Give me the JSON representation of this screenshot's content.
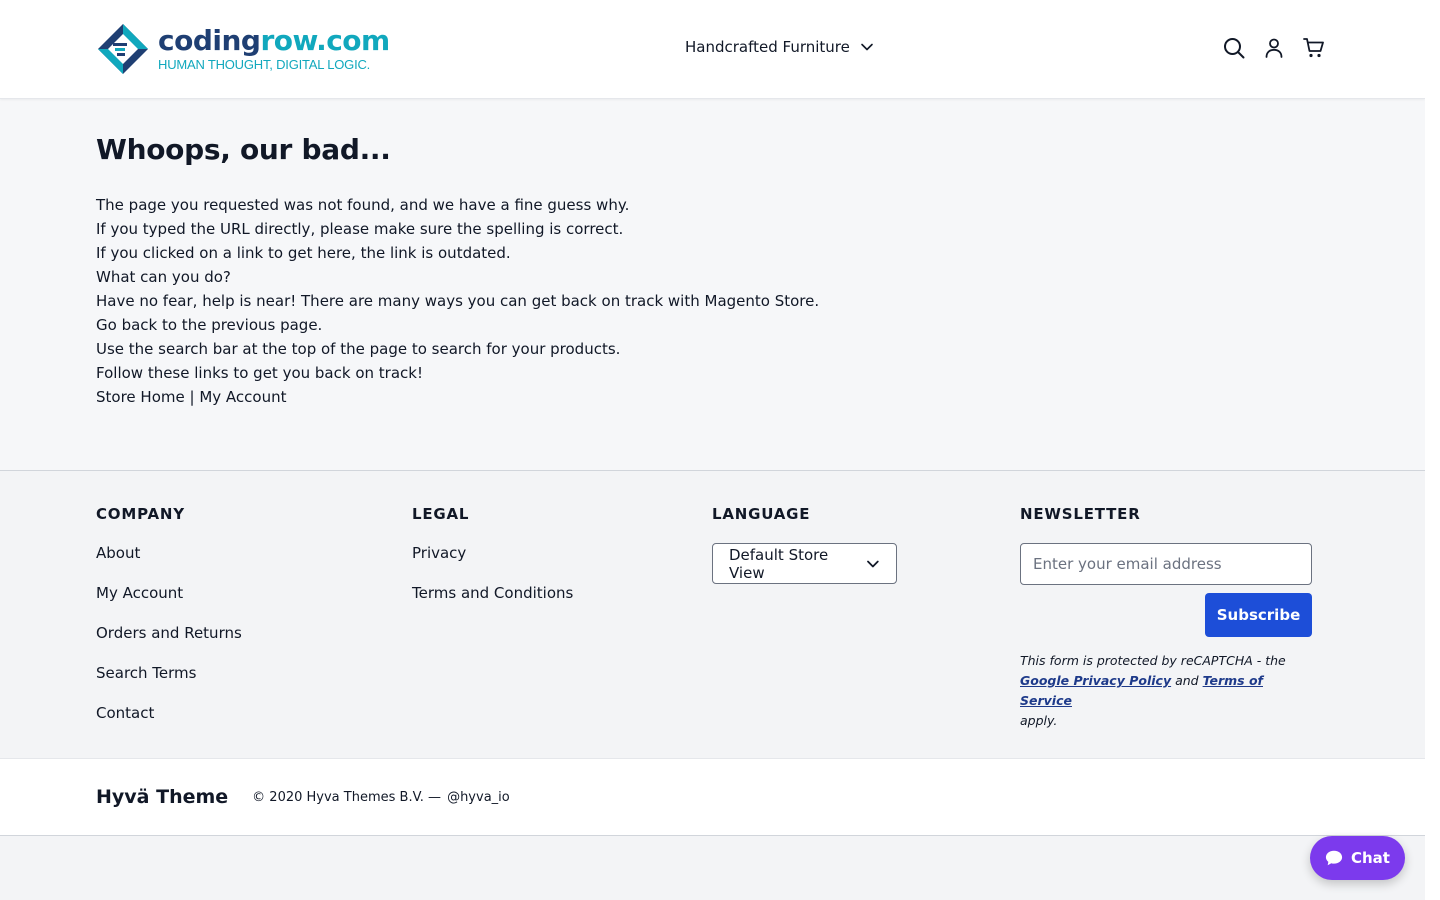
{
  "header": {
    "logo": {
      "name_part1": "coding",
      "name_part2": "row.com",
      "tagline": "HUMAN THOUGHT, DIGITAL LOGIC."
    },
    "nav_category": "Handcrafted Furniture",
    "icons": [
      "search-icon",
      "user-icon",
      "cart-icon"
    ]
  },
  "main": {
    "title": "Whoops, our bad...",
    "lines": [
      "The page you requested was not found, and we have a fine guess why.",
      "If you typed the URL directly, please make sure the spelling is correct.",
      "If you clicked on a link to get here, the link is outdated.",
      "What can you do?",
      "Have no fear, help is near! There are many ways you can get back on track with Magento Store.",
      "Go back to the previous page.",
      "Use the search bar at the top of the page to search for your products.",
      "Follow these links to get you back on track!"
    ],
    "store_home_link": "Store Home",
    "separator": " | ",
    "my_account_link": "My Account"
  },
  "footer": {
    "company": {
      "heading": "COMPANY",
      "links": [
        "About",
        "My Account",
        "Orders and Returns",
        "Search Terms",
        "Contact"
      ]
    },
    "legal": {
      "heading": "LEGAL",
      "links": [
        "Privacy",
        "Terms and Conditions"
      ]
    },
    "language": {
      "heading": "LANGUAGE",
      "selected": "Default Store View"
    },
    "newsletter": {
      "heading": "NEWSLETTER",
      "placeholder": "Enter your email address",
      "button": "Subscribe",
      "recaptcha_prefix": "This form is protected by reCAPTCHA - the",
      "privacy_link": "Google Privacy Policy",
      "and": "and",
      "terms_link": "Terms of Service",
      "suffix": "apply."
    }
  },
  "bottom": {
    "brand": "Hyvä Theme",
    "copyright": "© 2020 Hyva Themes B.V. —",
    "handle": "@hyva_io"
  },
  "chat": {
    "label": "Chat"
  },
  "colors": {
    "logo_dark": "#1f3f73",
    "logo_teal": "#11a8bd",
    "subscribe_blue": "#1d4ed8",
    "chat_purple": "#7c3aed"
  }
}
